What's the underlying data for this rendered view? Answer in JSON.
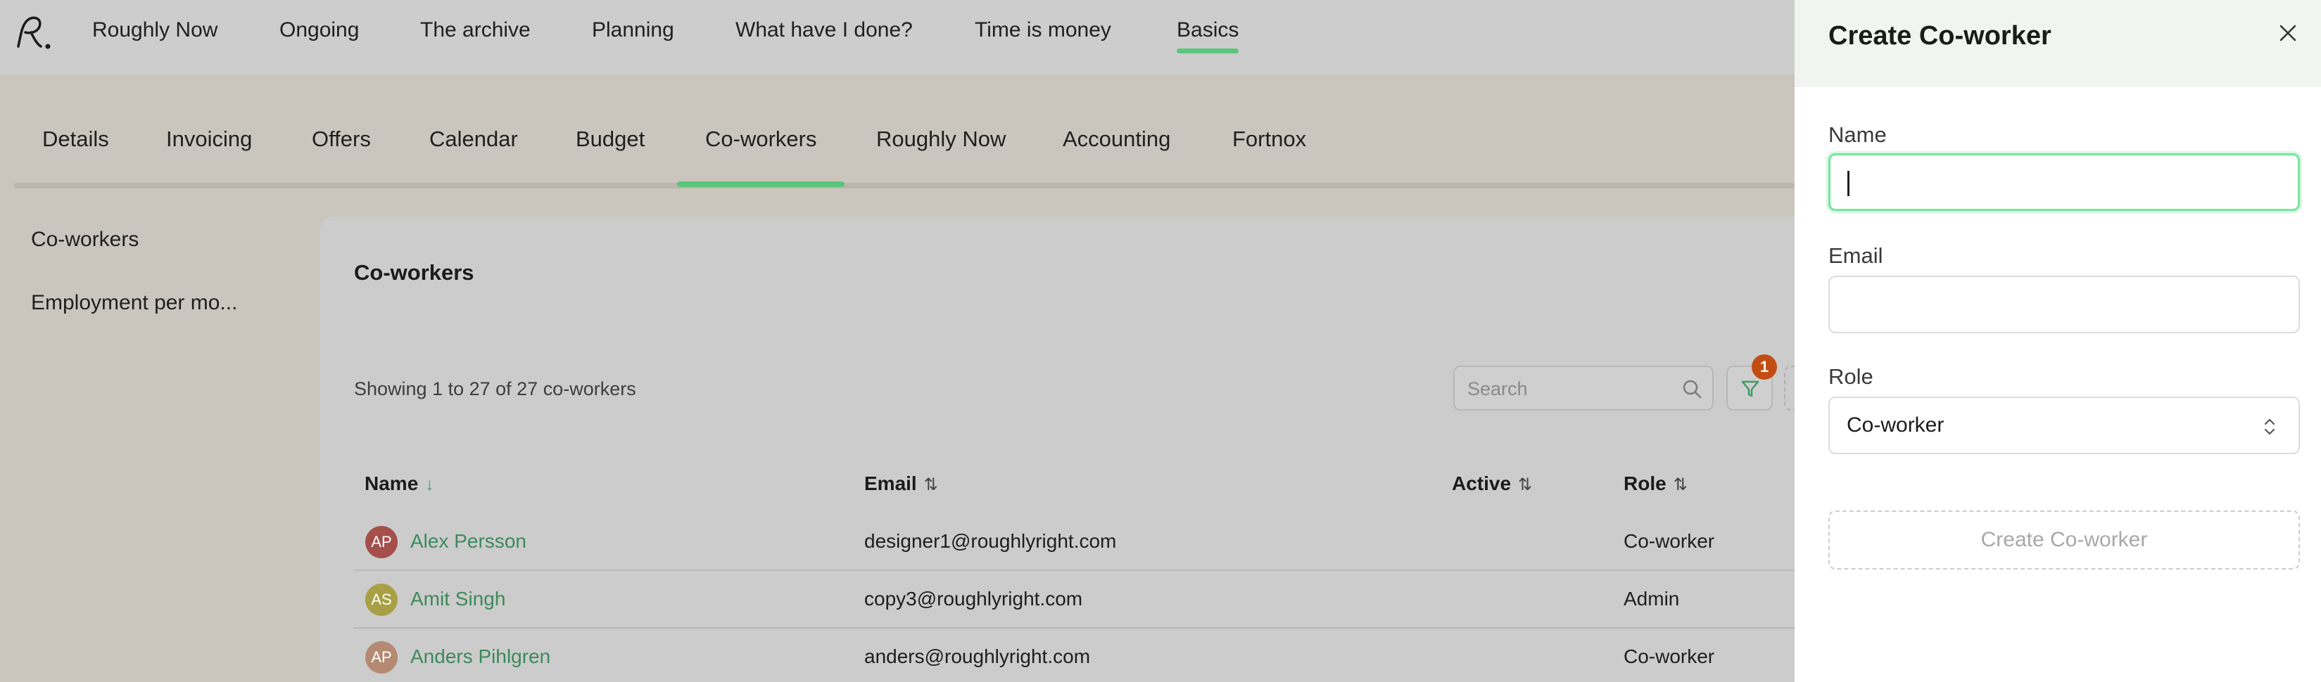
{
  "topnav": {
    "items": [
      {
        "label": "Roughly Now"
      },
      {
        "label": "Ongoing"
      },
      {
        "label": "The archive"
      },
      {
        "label": "Planning"
      },
      {
        "label": "What have I done?"
      },
      {
        "label": "Time is money"
      },
      {
        "label": "Basics",
        "active": true
      }
    ]
  },
  "subnav": {
    "tabs": [
      {
        "label": "Details"
      },
      {
        "label": "Invoicing"
      },
      {
        "label": "Offers"
      },
      {
        "label": "Calendar"
      },
      {
        "label": "Budget"
      },
      {
        "label": "Co-workers",
        "active": true
      },
      {
        "label": "Roughly Now"
      },
      {
        "label": "Accounting"
      },
      {
        "label": "Fortnox"
      }
    ]
  },
  "sidebar": {
    "items": [
      {
        "label": "Co-workers"
      },
      {
        "label": "Employment per mo..."
      }
    ]
  },
  "panel": {
    "title": "Co-workers",
    "showing": "Showing 1 to 27 of 27 co-workers",
    "search_placeholder": "Search",
    "filter_badge": "1"
  },
  "table": {
    "headers": {
      "name": "Name",
      "email": "Email",
      "active": "Active",
      "role": "Role"
    },
    "rows": [
      {
        "initials": "AP",
        "name": "Alex Persson",
        "email": "designer1@roughlyright.com",
        "role": "Co-worker",
        "avatar_color": "#a54f4b"
      },
      {
        "initials": "AS",
        "name": "Amit Singh",
        "email": "copy3@roughlyright.com",
        "role": "Admin",
        "avatar_color": "#a9a045"
      },
      {
        "initials": "AP",
        "name": "Anders Pihlgren",
        "email": "anders@roughlyright.com",
        "role": "Co-worker",
        "avatar_color": "#b58a72"
      }
    ]
  },
  "dialog": {
    "title": "Create Co-worker",
    "name_label": "Name",
    "name_value": "",
    "email_label": "Email",
    "email_value": "",
    "role_label": "Role",
    "role_value": "Co-worker",
    "submit_label": "Create Co-worker"
  },
  "colors": {
    "accent": "#5bc77c",
    "link": "#3c8a5c",
    "badge": "#c24d12"
  }
}
